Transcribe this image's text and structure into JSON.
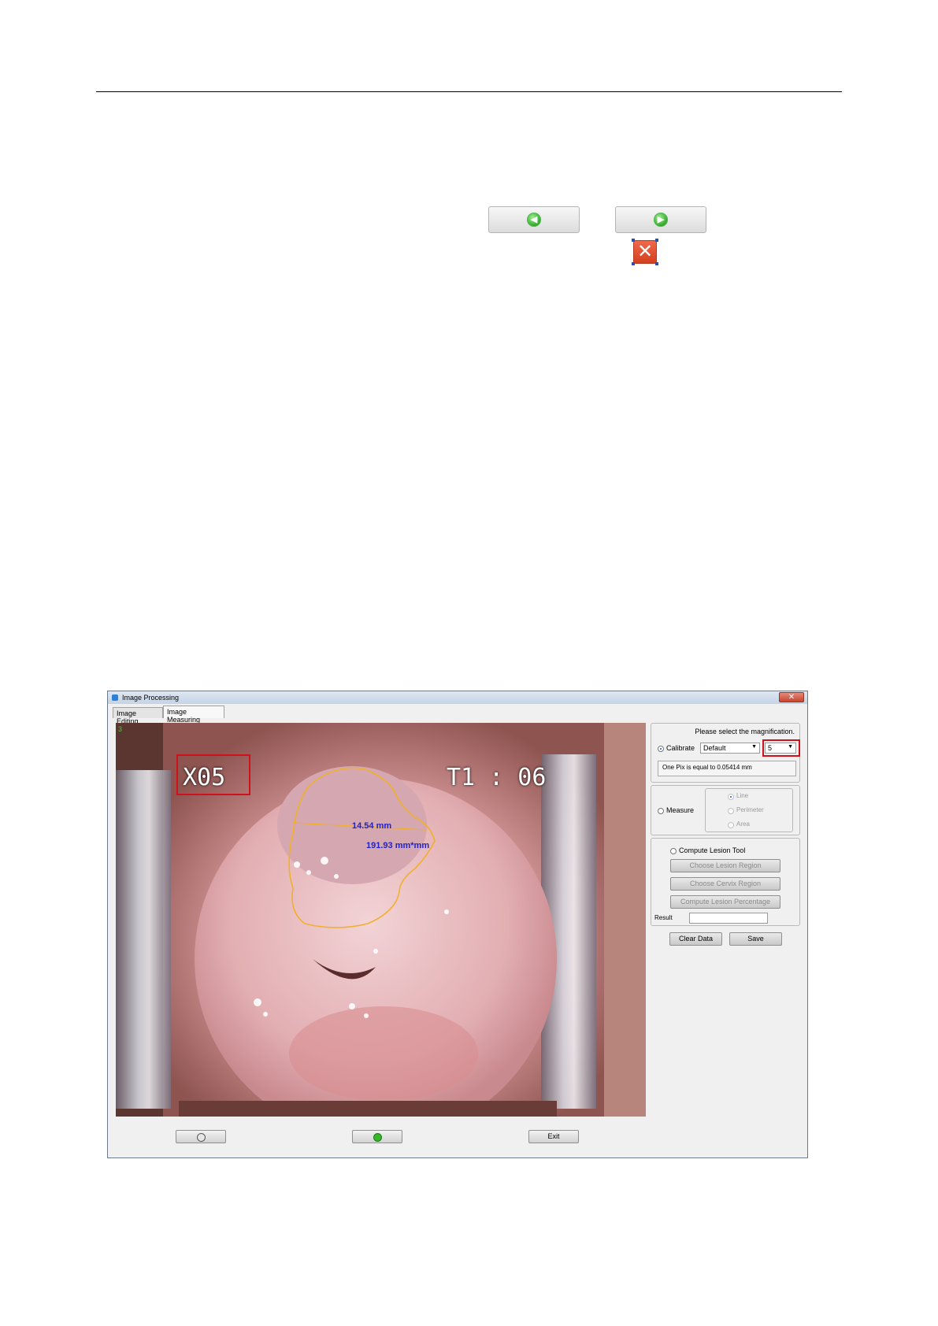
{
  "top_buttons": [
    {
      "name": "back-button",
      "icon": "arrow-left-icon",
      "color": "#2aa322"
    },
    {
      "name": "forward-button",
      "icon": "arrow-right-icon",
      "color": "#2aa322"
    }
  ],
  "delete_icon": {
    "icon": "close-icon",
    "color": "#d4401f"
  },
  "window": {
    "title": "Image Processing",
    "tabs": [
      {
        "label": "Image Editing",
        "active": false
      },
      {
        "label": "Image Measuring",
        "active": true
      }
    ],
    "image_overlay": {
      "frame_number": "3",
      "magnification_text": "X05",
      "time_text": "T1 : 06",
      "line_measurement": "14.54 mm",
      "area_measurement": "191.93 mm*mm"
    },
    "calibrate": {
      "prompt": "Please select the magnification.",
      "radio_label": "Calibrate",
      "preset_value": "Default",
      "magnification_value": "5",
      "pixel_info": "One Pix is equal to 0.05414 mm"
    },
    "measure": {
      "radio_label": "Measure",
      "options": [
        "Line",
        "Perimeter",
        "Area"
      ]
    },
    "lesion": {
      "radio_label": "Compute Lesion Tool",
      "choose_lesion": "Choose Lesion Region",
      "choose_cervix": "Choose Cervix Region",
      "compute_percentage": "Compute Lesion Percentage",
      "result_label": "Result",
      "result_value": ""
    },
    "actions": {
      "clear": "Clear Data",
      "save": "Save"
    },
    "bottom": {
      "exit": "Exit"
    }
  }
}
